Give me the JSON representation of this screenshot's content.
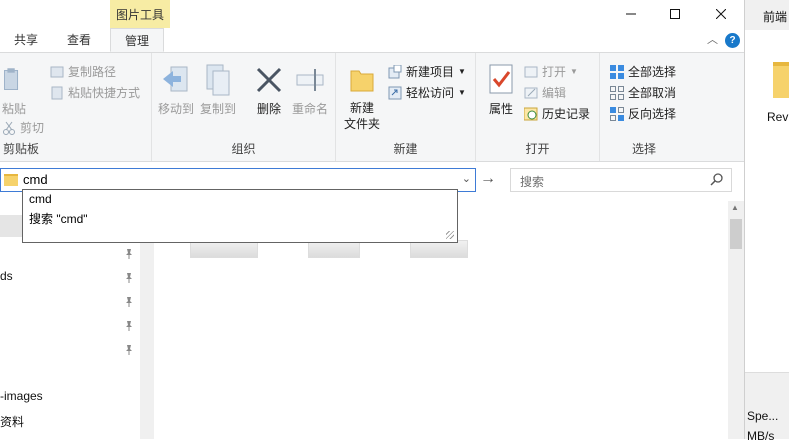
{
  "window": {
    "contextual_tab_group": "图片工具",
    "tabs": [
      {
        "label": "共享"
      },
      {
        "label": "查看"
      },
      {
        "label": "管理"
      }
    ],
    "help_label": "?"
  },
  "ribbon": {
    "clipboard": {
      "label": "剪贴板",
      "paste": "粘贴",
      "copy_path": "复制路径",
      "paste_shortcut": "粘贴快捷方式",
      "cut": "剪切"
    },
    "organize": {
      "label": "组织",
      "move_to": "移动到",
      "copy_to": "复制到",
      "delete": "删除",
      "rename": "重命名"
    },
    "new": {
      "label": "新建",
      "new_folder": "新建\n文件夹",
      "new_item": "新建项目",
      "easy_access": "轻松访问"
    },
    "open": {
      "label": "打开",
      "properties": "属性",
      "open": "打开",
      "edit": "编辑",
      "history": "历史记录"
    },
    "select": {
      "label": "选择",
      "select_all": "全部选择",
      "select_none": "全部取消",
      "invert": "反向选择"
    }
  },
  "address": {
    "value": "cmd",
    "search_placeholder": "搜索"
  },
  "autocomplete": {
    "items": [
      "cmd",
      "搜索 \"cmd\""
    ]
  },
  "nav": {
    "items": [
      {
        "label": "ds"
      },
      {
        "label": "-images"
      },
      {
        "label": "资料"
      }
    ]
  },
  "side_window": {
    "title_fragment": "前端",
    "folder_label": "Rev",
    "bottom_label1": "Spe...",
    "bottom_label2": "MB/s"
  }
}
